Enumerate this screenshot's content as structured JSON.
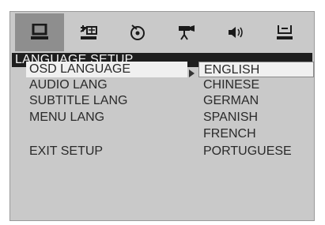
{
  "tabs": [
    {
      "icon": "general-setup-icon",
      "active": true
    },
    {
      "icon": "language-setup-icon",
      "active": false
    },
    {
      "icon": "audio-setup-icon",
      "active": false
    },
    {
      "icon": "video-setup-icon",
      "active": false
    },
    {
      "icon": "speaker-setup-icon",
      "active": false
    },
    {
      "icon": "preference-setup-icon",
      "active": false
    }
  ],
  "header": {
    "title": "LANGUAGE SETUP"
  },
  "menu": {
    "items": [
      {
        "label": "OSD LANGUAGE"
      },
      {
        "label": "AUDIO LANG"
      },
      {
        "label": "SUBTITLE LANG"
      },
      {
        "label": "MENU LANG"
      },
      {
        "label": "EXIT SETUP"
      }
    ],
    "selected": "OSD LANGUAGE"
  },
  "options": {
    "items": [
      {
        "label": "ENGLISH"
      },
      {
        "label": "CHINESE"
      },
      {
        "label": "GERMAN"
      },
      {
        "label": "SPANISH"
      },
      {
        "label": "FRENCH"
      },
      {
        "label": "PORTUGUESE"
      }
    ],
    "selected": "ENGLISH"
  },
  "colors": {
    "header_bg": "#1e1e1e",
    "screen_bg": "#c9c9c9",
    "highlight": "#f0f0f0",
    "active_tab": "#8e8e8e"
  }
}
